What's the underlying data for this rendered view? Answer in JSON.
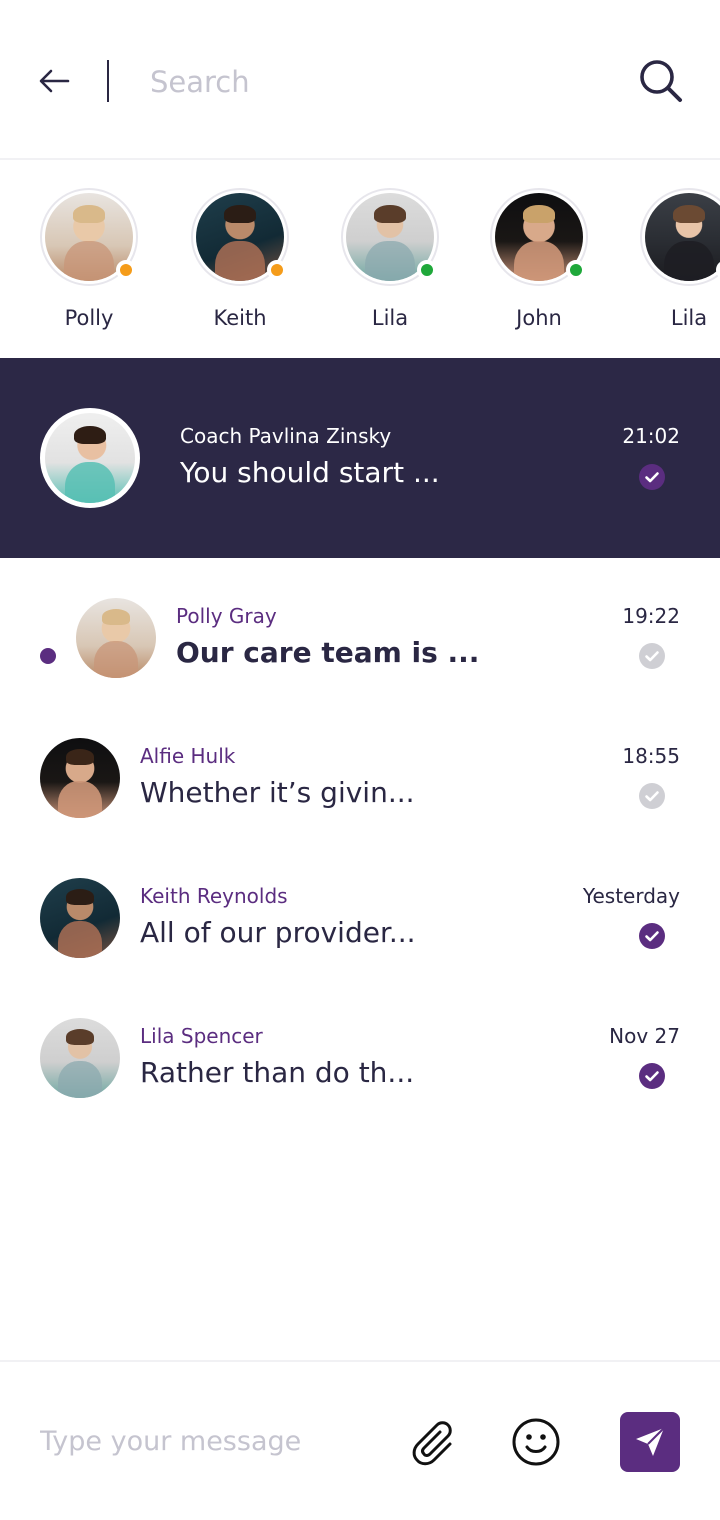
{
  "search": {
    "placeholder": "Search"
  },
  "stories": [
    {
      "name": "Polly",
      "status": "away",
      "status_color": "#f59c1a"
    },
    {
      "name": "Keith",
      "status": "away",
      "status_color": "#f59c1a"
    },
    {
      "name": "Lila",
      "status": "online",
      "status_color": "#1fa83a"
    },
    {
      "name": "John",
      "status": "online",
      "status_color": "#1fa83a"
    },
    {
      "name": "Lila",
      "status": "online",
      "status_color": "#1fa83a"
    }
  ],
  "active_chat": {
    "name": "Coach Pavlina Zinsky",
    "preview": "You should start ...",
    "time": "21:02",
    "read": true
  },
  "conversations": [
    {
      "name": "Polly Gray",
      "preview": "Our care team is ...",
      "time": "19:22",
      "unread": true,
      "read": false
    },
    {
      "name": "Alfie Hulk",
      "preview": "Whether it’s givin...",
      "time": "18:55",
      "unread": false,
      "read": false
    },
    {
      "name": "Keith Reynolds",
      "preview": "All of our provider...",
      "time": "Yesterday",
      "unread": false,
      "read": true
    },
    {
      "name": "Lila Spencer",
      "preview": "Rather than do th...",
      "time": "Nov 27",
      "unread": false,
      "read": true
    }
  ],
  "composer": {
    "placeholder": "Type your message"
  },
  "colors": {
    "brand": "#5b2d80",
    "dark": "#2c2846",
    "read_check": "#5b2d80",
    "delivered_check": "#cfcfd4",
    "away": "#f59c1a",
    "online": "#1fa83a"
  },
  "icons": {
    "back": "arrow-left-icon",
    "search": "search-icon",
    "attach": "paperclip-icon",
    "emoji": "smiley-icon",
    "send": "send-icon",
    "check": "check-circle-icon"
  }
}
